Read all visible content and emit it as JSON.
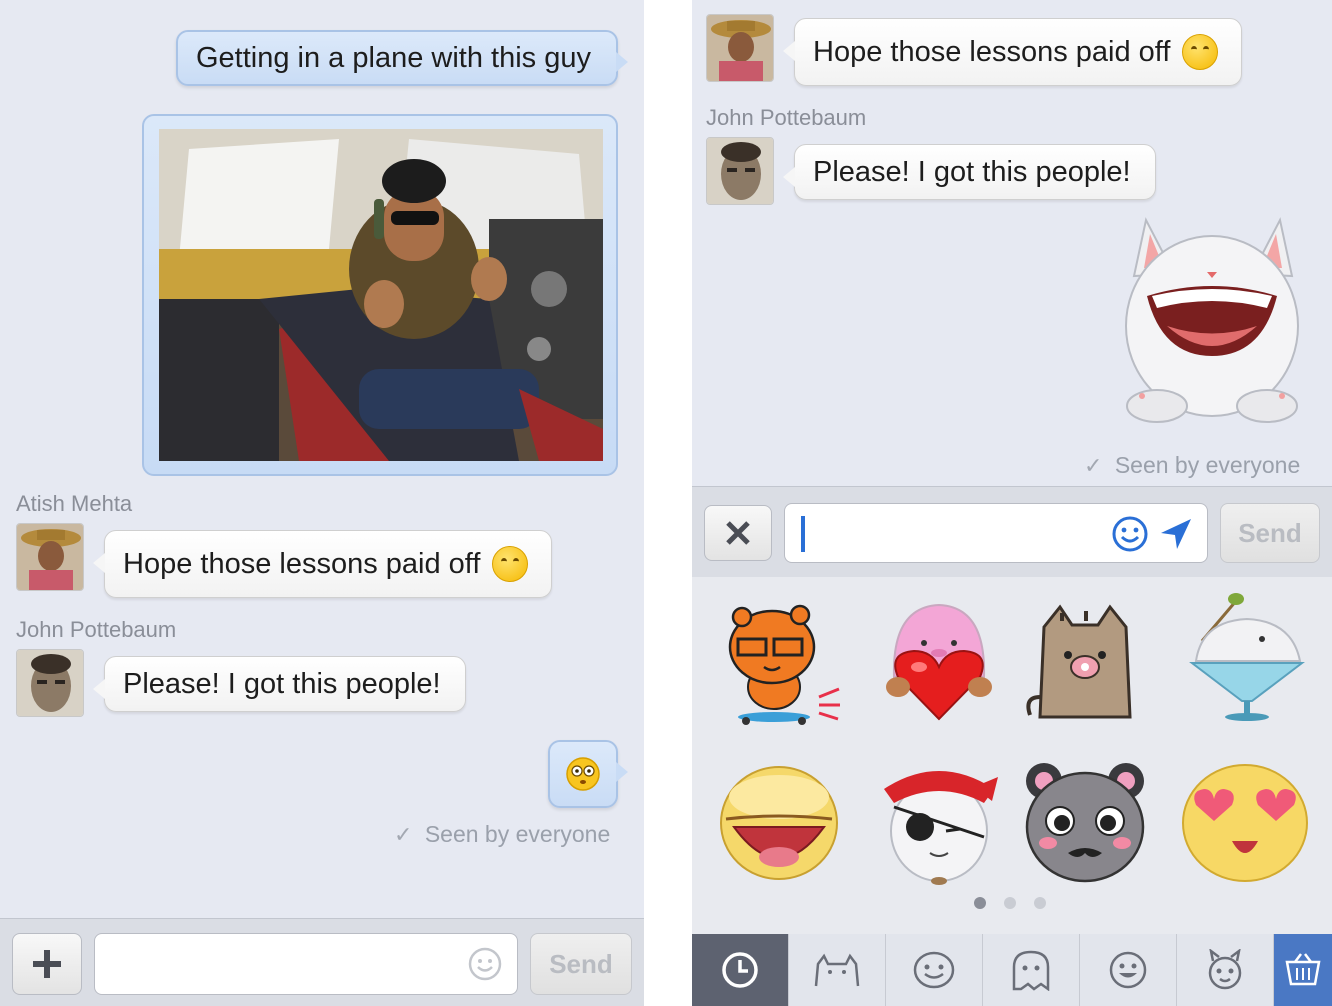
{
  "left": {
    "msg_plane": "Getting in a plane with this guy",
    "name_atish": "Atish Mehta",
    "msg_lessons": "Hope those lessons paid off",
    "name_john": "John Pottebaum",
    "msg_please": "Please! I got this people!",
    "seen": "Seen by everyone",
    "send": "Send"
  },
  "right": {
    "msg_lessons": "Hope those lessons paid off",
    "name_john": "John Pottebaum",
    "msg_please": "Please! I got this people!",
    "seen": "Seen by everyone",
    "send": "Send",
    "stickers": [
      "tiger-skateboard",
      "pink-blob-heart",
      "pusheen-cat",
      "bird-cocktail",
      "yellow-open-mouth",
      "pirate-cat",
      "panda-mustache",
      "heart-eyes"
    ],
    "page_dots": {
      "count": 3,
      "active": 0
    },
    "tabs": [
      "recent-clock-icon",
      "cat-icon",
      "smiley-icon",
      "ghost-icon",
      "grin-icon",
      "horned-face-icon",
      "store-basket-icon"
    ]
  },
  "colors": {
    "background": "#e6e9f2",
    "outgoing": "#c9dcf5",
    "accent": "#2a6fd6",
    "store_tab": "#4a78c4"
  }
}
